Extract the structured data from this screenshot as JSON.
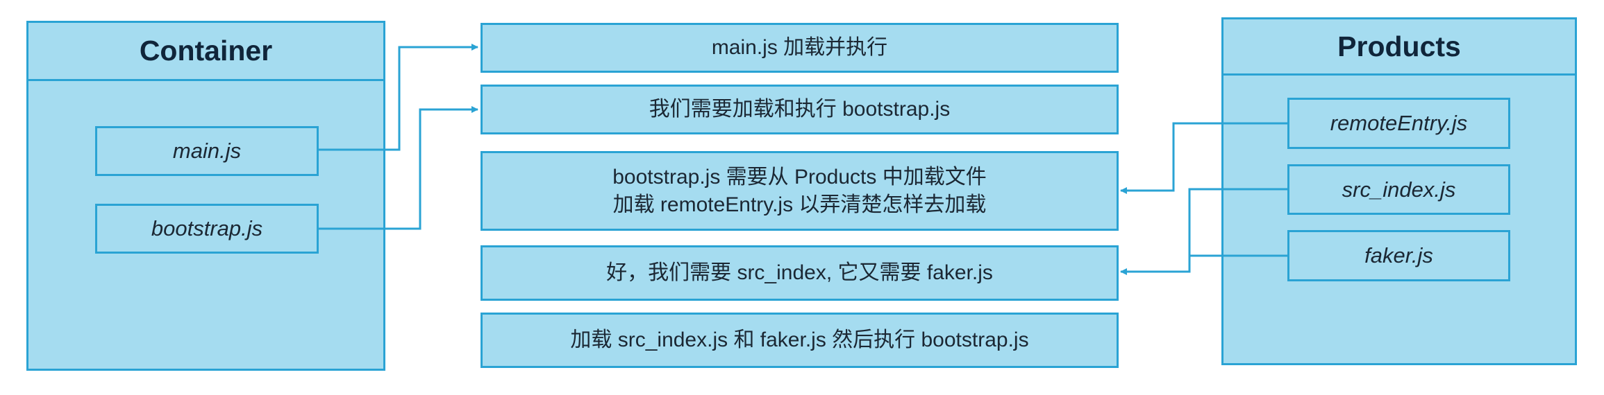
{
  "container": {
    "title": "Container",
    "files": [
      "main.js",
      "bootstrap.js"
    ]
  },
  "products": {
    "title": "Products",
    "files": [
      "remoteEntry.js",
      "src_index.js",
      "faker.js"
    ]
  },
  "steps": [
    {
      "lines": [
        "main.js 加载并执行"
      ]
    },
    {
      "lines": [
        "我们需要加载和执行 bootstrap.js"
      ]
    },
    {
      "lines": [
        "bootstrap.js 需要从 Products 中加载文件",
        "加载 remoteEntry.js 以弄清楚怎样去加载"
      ]
    },
    {
      "lines": [
        "好，我们需要 src_index, 它又需要 faker.js"
      ]
    },
    {
      "lines": [
        "加载 src_index.js 和 faker.js 然后执行 bootstrap.js"
      ]
    }
  ],
  "colors": {
    "fill": "#a5dcf0",
    "border": "#2aa3d4",
    "arrow": "#2aa3d4",
    "text": "#1b2733"
  }
}
